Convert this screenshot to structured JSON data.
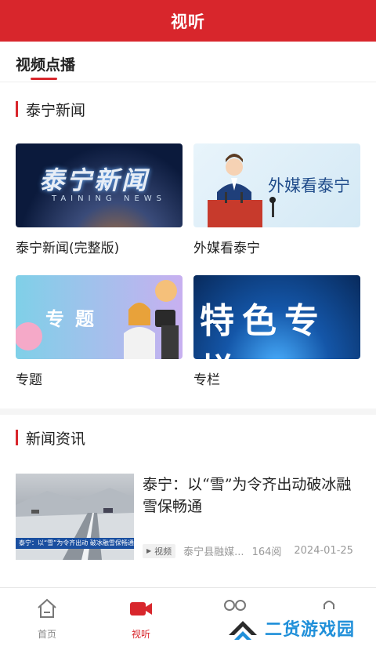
{
  "header": {
    "title": "视听"
  },
  "tabs": {
    "active_label": "视频点播"
  },
  "section_taining": {
    "title": "泰宁新闻",
    "cards": [
      {
        "label": "泰宁新闻(完整版)",
        "thumb_text": "泰宁新闻",
        "thumb_sub": "TAINING NEWS"
      },
      {
        "label": "外媒看泰宁",
        "thumb_text": "外媒看泰宁"
      },
      {
        "label": "专题",
        "thumb_text": "专题"
      },
      {
        "label": "专栏",
        "thumb_text": "特色专栏"
      }
    ]
  },
  "section_news": {
    "title": "新闻资讯",
    "items": [
      {
        "title": "泰宁：以“雪”为令齐出动破冰融雪保畅通",
        "thumb_caption": "泰宁：以“雪”为令齐出动 破冰融雪保畅通",
        "tag": "视频",
        "source": "泰宁县融媒...",
        "views": "164阅",
        "date": "2024-01-25"
      }
    ]
  },
  "bottom_nav": [
    {
      "label": "首页",
      "icon": "home-icon",
      "active": false
    },
    {
      "label": "视听",
      "icon": "video-camera-icon",
      "active": true
    },
    {
      "label": "",
      "icon": "community-icon",
      "active": false
    },
    {
      "label": "",
      "icon": "profile-icon",
      "active": false
    }
  ],
  "watermark": {
    "text": "二货游戏园"
  },
  "colors": {
    "brand_red": "#d8262c",
    "watermark_blue": "#1f8fd9"
  }
}
